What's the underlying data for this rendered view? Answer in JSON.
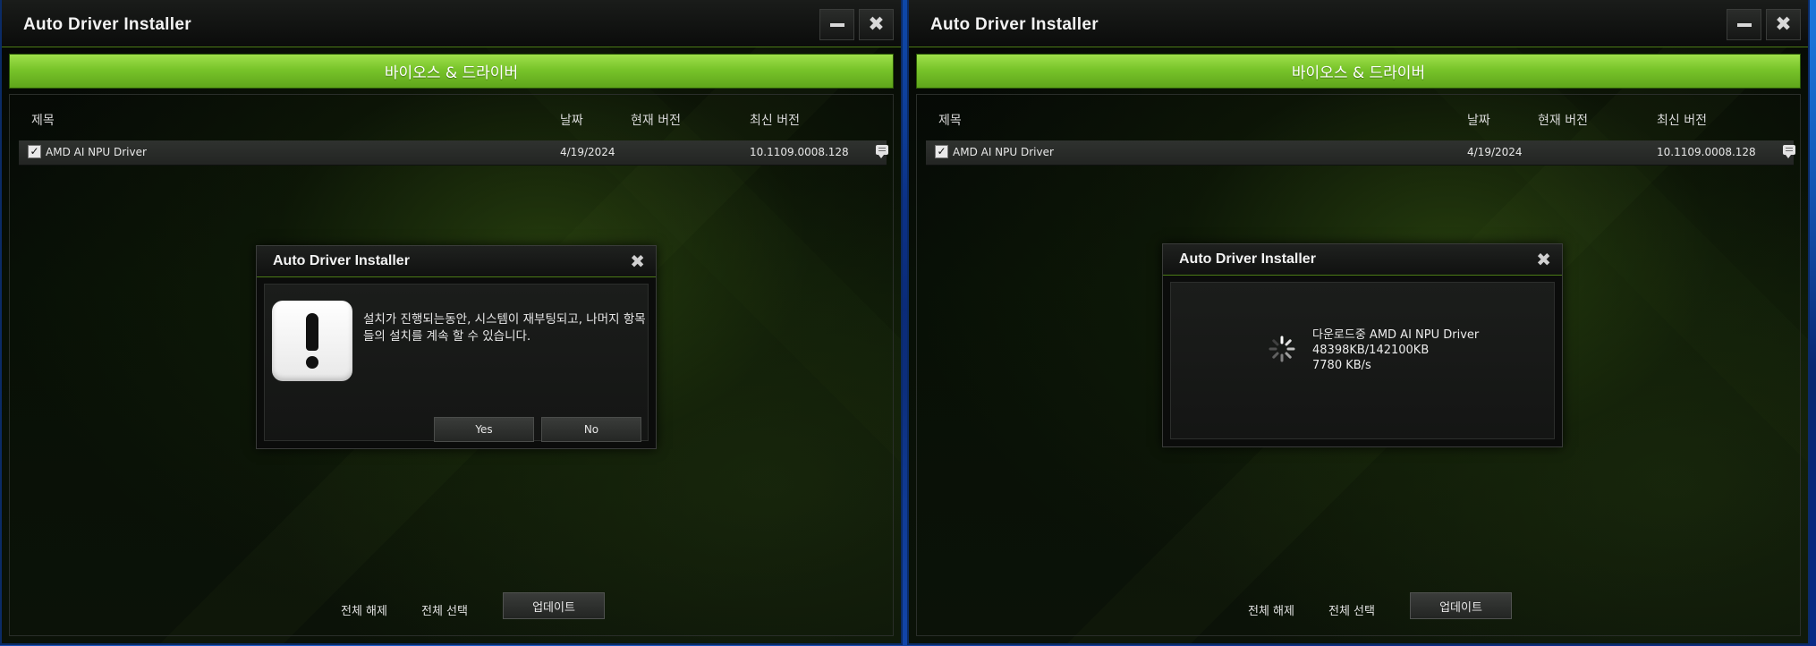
{
  "left_window": {
    "title": "Auto Driver Installer",
    "tab_label": "바이오스 & 드라이버",
    "columns": {
      "title": "제목",
      "date": "날짜",
      "current": "현재 버전",
      "latest": "최신 버전"
    },
    "row": {
      "checked": "✓",
      "name": "AMD AI NPU Driver",
      "date": "4/19/2024",
      "latest": "10.1109.0008.128"
    },
    "deselect_all": "전체 해제",
    "select_all": "전체 선택",
    "update": "업데이트",
    "dialog": {
      "title": "Auto Driver Installer",
      "message": "설치가 진행되는동안, 시스템이 재부팅되고, 나머지 항목들의 설치를 계속 할 수 있습니다.",
      "yes": "Yes",
      "no": "No",
      "icon": "exclamation-icon"
    }
  },
  "right_window": {
    "title": "Auto Driver Installer",
    "tab_label": "바이오스 & 드라이버",
    "columns": {
      "title": "제목",
      "date": "날짜",
      "current": "현재 버전",
      "latest": "최신 버전"
    },
    "row": {
      "checked": "✓",
      "name": "AMD AI NPU Driver",
      "date": "4/19/2024",
      "latest": "10.1109.0008.128"
    },
    "deselect_all": "전체 해제",
    "select_all": "전체 선택",
    "update": "업데이트",
    "dialog": {
      "title": "Auto Driver Installer",
      "line1": "다운로드중 AMD AI NPU Driver",
      "line2": "48398KB/142100KB",
      "line3": "7780 KB/s",
      "icon": "loading-spinner-icon"
    }
  },
  "colors": {
    "accent_green": "#78c42a",
    "window_bg": "#060806",
    "desktop_blue": "#0a2a7a"
  }
}
